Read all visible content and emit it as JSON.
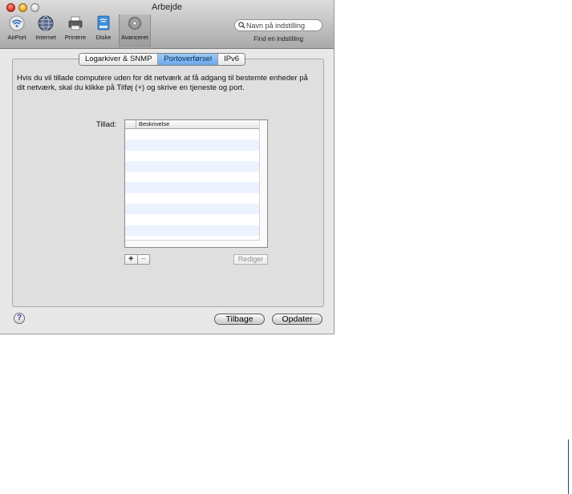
{
  "window": {
    "title": "Arbejde"
  },
  "toolbar": {
    "items": [
      {
        "label": "AirPort",
        "icon": "airport-icon"
      },
      {
        "label": "Internet",
        "icon": "internet-globe-icon"
      },
      {
        "label": "Printere",
        "icon": "printer-icon"
      },
      {
        "label": "Diske",
        "icon": "disk-icon"
      },
      {
        "label": "Avanceret",
        "icon": "gear-icon",
        "selected": true
      }
    ],
    "search": {
      "placeholder": "Navn på indstilling",
      "caption": "Find en indstilling"
    }
  },
  "tabs": [
    {
      "label": "Logarkiver & SNMP",
      "active": false
    },
    {
      "label": "Portoverførsel",
      "active": true
    },
    {
      "label": "IPv6",
      "active": false
    }
  ],
  "main": {
    "description": "Hvis du vil tillade computere uden for dit netværk at få adgang til bestemte enheder på dit netværk, skal du klikke på Tilføj (+) og skrive en tjeneste og port.",
    "allow_label": "Tillad:",
    "table": {
      "column_header": "Beskrivelse",
      "rows": []
    },
    "add_label": "+",
    "remove_label": "−",
    "edit_label": "Rediger"
  },
  "footer": {
    "help_label": "?",
    "back_label": "Tilbage",
    "update_label": "Opdater"
  },
  "colors": {
    "active_tab": "#7bb4ef",
    "table_stripe": "#edf3fe",
    "margin_rule": "#0c4da2"
  }
}
